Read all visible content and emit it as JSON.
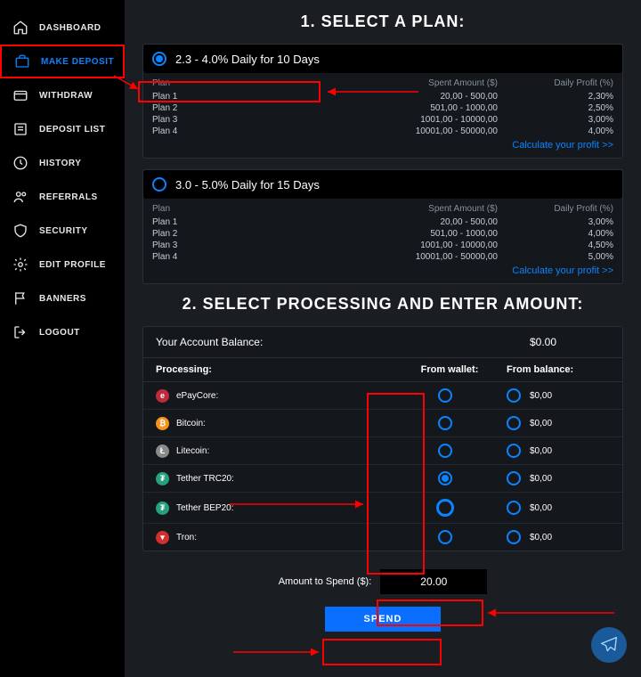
{
  "sidebar": {
    "items": [
      {
        "label": "DASHBOARD",
        "icon": "home"
      },
      {
        "label": "MAKE DEPOSIT",
        "icon": "briefcase",
        "active": true
      },
      {
        "label": "WITHDRAW",
        "icon": "wallet"
      },
      {
        "label": "DEPOSIT LIST",
        "icon": "list"
      },
      {
        "label": "HISTORY",
        "icon": "clock"
      },
      {
        "label": "REFERRALS",
        "icon": "users"
      },
      {
        "label": "SECURITY",
        "icon": "shield"
      },
      {
        "label": "EDIT PROFILE",
        "icon": "gear"
      },
      {
        "label": "BANNERS",
        "icon": "flag"
      },
      {
        "label": "LOGOUT",
        "icon": "logout"
      }
    ]
  },
  "step1_title": "1. SELECT A PLAN:",
  "step2_title": "2. SELECT PROCESSING AND ENTER AMOUNT:",
  "plan_table": {
    "col_plan": "Plan",
    "col_spent": "Spent Amount ($)",
    "col_profit": "Daily Profit (%)",
    "calc_link": "Calculate your profit >>"
  },
  "plans": [
    {
      "title": "2.3 - 4.0% Daily for 10 Days",
      "selected": true,
      "rows": [
        {
          "name": "Plan 1",
          "range": "20,00 - 500,00",
          "profit": "2,30%"
        },
        {
          "name": "Plan 2",
          "range": "501,00 - 1000,00",
          "profit": "2,50%"
        },
        {
          "name": "Plan 3",
          "range": "1001,00 - 10000,00",
          "profit": "3,00%"
        },
        {
          "name": "Plan 4",
          "range": "10001,00 - 50000,00",
          "profit": "4,00%"
        }
      ]
    },
    {
      "title": "3.0 - 5.0% Daily for 15 Days",
      "selected": false,
      "rows": [
        {
          "name": "Plan 1",
          "range": "20,00 - 500,00",
          "profit": "3,00%"
        },
        {
          "name": "Plan 2",
          "range": "501,00 - 1000,00",
          "profit": "4,00%"
        },
        {
          "name": "Plan 3",
          "range": "1001,00 - 10000,00",
          "profit": "4,50%"
        },
        {
          "name": "Plan 4",
          "range": "10001,00 - 50000,00",
          "profit": "5,00%"
        }
      ]
    }
  ],
  "balance": {
    "label": "Your Account Balance:",
    "value": "$0.00"
  },
  "proc_head": {
    "col1": "Processing:",
    "col2": "From wallet:",
    "col3": "From balance:"
  },
  "processors": [
    {
      "name": "ePayCore:",
      "color": "#c02a3a",
      "glyph": "e",
      "wallet_selected": false,
      "balance": "$0,00"
    },
    {
      "name": "Bitcoin:",
      "color": "#f7931a",
      "glyph": "₿",
      "wallet_selected": false,
      "balance": "$0,00"
    },
    {
      "name": "Litecoin:",
      "color": "#8a8a8a",
      "glyph": "Ł",
      "wallet_selected": false,
      "balance": "$0,00"
    },
    {
      "name": "Tether TRC20:",
      "color": "#26a17b",
      "glyph": "₮",
      "wallet_selected": true,
      "balance": "$0,00"
    },
    {
      "name": "Tether BEP20:",
      "color": "#26a17b",
      "glyph": "₮",
      "wallet_selected": false,
      "balance": "$0,00"
    },
    {
      "name": "Tron:",
      "color": "#d32f2f",
      "glyph": "▾",
      "wallet_selected": false,
      "balance": "$0,00"
    }
  ],
  "amount": {
    "label": "Amount to Spend ($):",
    "value": "20.00",
    "button": "SPEND"
  }
}
